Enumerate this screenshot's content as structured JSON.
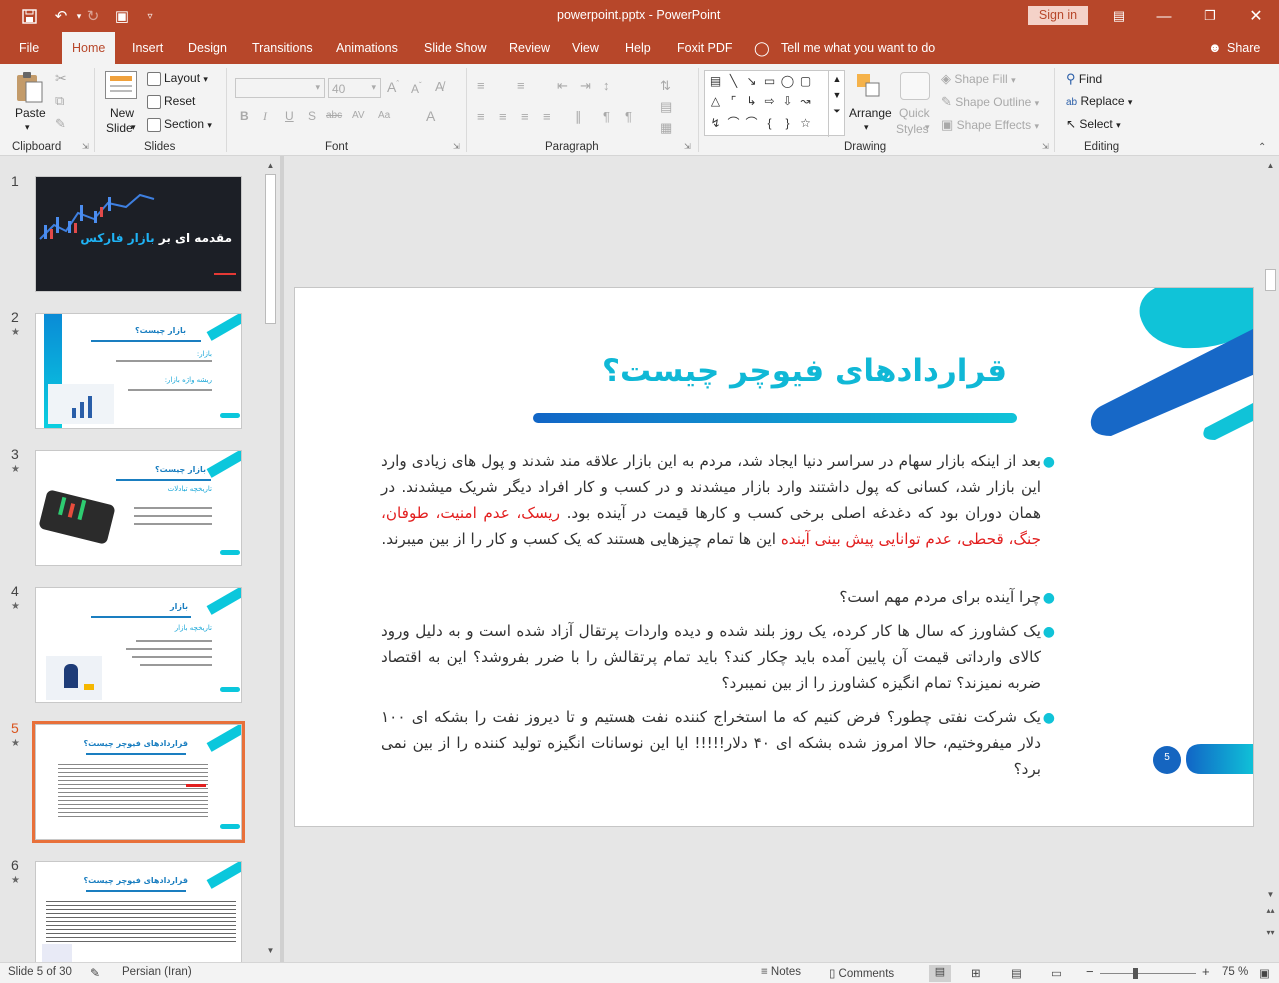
{
  "title_bar": {
    "document": "powerpoint.pptx",
    "separator": " - ",
    "app": "PowerPoint",
    "sign_in": "Sign in"
  },
  "tabs": {
    "file": "File",
    "home": "Home",
    "insert": "Insert",
    "design": "Design",
    "transitions": "Transitions",
    "animations": "Animations",
    "slide_show": "Slide Show",
    "review": "Review",
    "view": "View",
    "help": "Help",
    "foxit": "Foxit PDF",
    "tell_me": "Tell me what you want to do",
    "share": "Share"
  },
  "ribbon": {
    "clipboard": {
      "paste": "Paste",
      "label": "Clipboard"
    },
    "slides": {
      "new_slide_1": "New",
      "new_slide_2": "Slide",
      "layout": "Layout",
      "reset": "Reset",
      "section": "Section",
      "label": "Slides"
    },
    "font": {
      "size": "40",
      "label": "Font"
    },
    "paragraph": {
      "label": "Paragraph"
    },
    "drawing": {
      "arrange": "Arrange",
      "quick_styles_1": "Quick",
      "quick_styles_2": "Styles",
      "shape_fill": "Shape Fill",
      "shape_outline": "Shape Outline",
      "shape_effects": "Shape Effects",
      "label": "Drawing"
    },
    "editing": {
      "find": "Find",
      "replace": "Replace",
      "select": "Select",
      "label": "Editing"
    }
  },
  "thumbnails": [
    {
      "num": "1",
      "title_a": "مقدمه ای بر ",
      "title_b": "بازار فارکس"
    },
    {
      "num": "2",
      "title": "بازار چیست؟",
      "h1": "بازار:",
      "h2": "ریشه واژه بازار:"
    },
    {
      "num": "3",
      "title": "بازار چیست؟",
      "sub": "تاریخچه تبادلات"
    },
    {
      "num": "4",
      "title": "بازار",
      "sub": "تاریخچه بازار"
    },
    {
      "num": "5",
      "title": "قراردادهای فیوچر چیست؟"
    },
    {
      "num": "6",
      "title": "قراردادهای فیوچر چیست؟"
    }
  ],
  "slide": {
    "title": "قراردادهای فیوچر چیست؟",
    "bullet1": "بعد از اینکه بازار سهام در سراسر دنیا ایجاد شد، مردم به این بازار علاقه مند شدند و پول های زیادی وارد این بازار شد، کسانی که پول داشتند وارد بازار میشدند و در کسب و کار افراد دیگر شریک میشدند. در همان دوران بود که دغدغه اصلی برخی کسب و کارها قیمت در آینده بود.",
    "bullet1_red": "ریسک، عدم امنیت، طوفان، جنگ، قحطی، عدم توانایی پیش بینی آینده",
    "bullet1_end": " این ها تمام چیزهایی هستند که یک کسب و کار را از بین میبرند.",
    "bullet2": "چرا آینده برای مردم مهم است؟",
    "bullet3": "یک کشاورز که سال ها کار کرده، یک روز بلند شده و دیده واردات پرتقال آزاد شده است و به دلیل ورود کالای وارداتی قیمت آن پایین آمده باید چکار کند؟ باید تمام پرتقالش را با ضرر بفروشد؟ این به اقتصاد ضربه نمیزند؟ تمام انگیزه کشاورز را از بین نمیبرد؟",
    "bullet4": "یک شرکت نفتی چطور؟ فرض کنیم که ما استخراج کننده نفت هستیم و تا دیروز نفت را بشکه ای ۱۰۰ دلار میفروختیم، حالا امروز شده بشکه ای ۴۰ دلار!!!!! ایا این نوسانات انگیزه تولید کننده را از بین نمی برد؟",
    "page_number": "5"
  },
  "status": {
    "slide_of": "Slide 5 of 30",
    "language": "Persian (Iran)",
    "notes": "Notes",
    "comments": "Comments",
    "zoom": "75 %",
    "zoom_level": 0.75
  },
  "colors": {
    "accent": "#b7472a",
    "slide_cyan": "#10c3d8",
    "slide_blue": "#1565c0",
    "selected_thumb": "#e8703a"
  }
}
